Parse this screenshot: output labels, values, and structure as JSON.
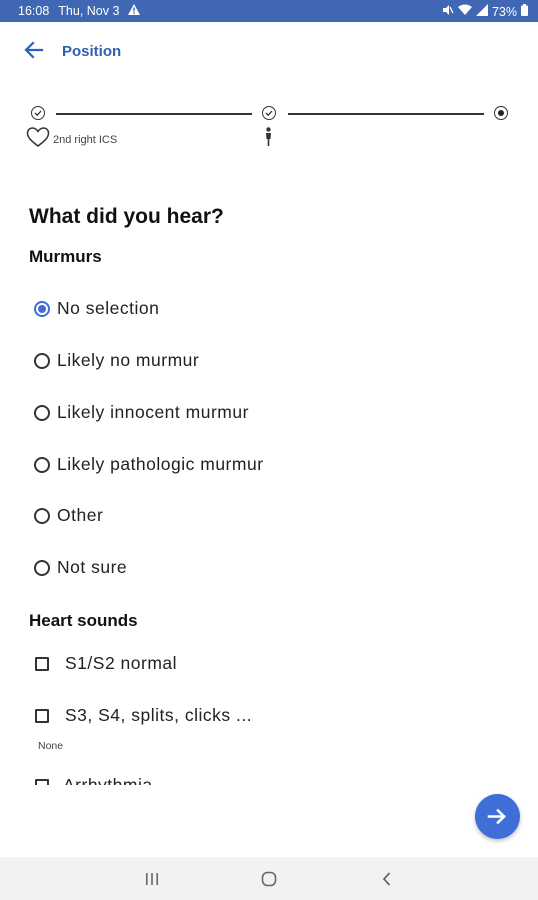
{
  "status_bar": {
    "time": "16:08",
    "date": "Thu, Nov 3",
    "battery": "73%",
    "background_color": "#3f67b4"
  },
  "app_bar": {
    "title": "Position",
    "back_icon": "arrow-left-icon",
    "accent_color": "#2f5fb3"
  },
  "stepper": {
    "steps": [
      {
        "state": "completed",
        "icon": "check-circle-icon"
      },
      {
        "state": "completed",
        "icon": "check-circle-icon"
      },
      {
        "state": "current",
        "icon": "radio-circle-icon"
      }
    ],
    "step1_label": "2nd right ICS"
  },
  "question": {
    "title": "What did you hear?"
  },
  "murmurs": {
    "heading": "Murmurs",
    "options": [
      {
        "label": "No selection",
        "selected": true
      },
      {
        "label": "Likely no murmur",
        "selected": false
      },
      {
        "label": "Likely innocent murmur",
        "selected": false
      },
      {
        "label": "Likely pathologic murmur",
        "selected": false
      },
      {
        "label": "Other",
        "selected": false
      },
      {
        "label": "Not sure",
        "selected": false
      }
    ]
  },
  "heart_sounds": {
    "heading": "Heart sounds",
    "options": [
      {
        "label": "S1/S2 normal",
        "checked": false
      },
      {
        "label": "S3, S4, splits, clicks ...",
        "checked": false,
        "note": "None"
      }
    ],
    "partial_option_label": "Arrhythmia"
  },
  "fab": {
    "icon": "arrow-right-icon",
    "color": "#3f6fd6"
  }
}
